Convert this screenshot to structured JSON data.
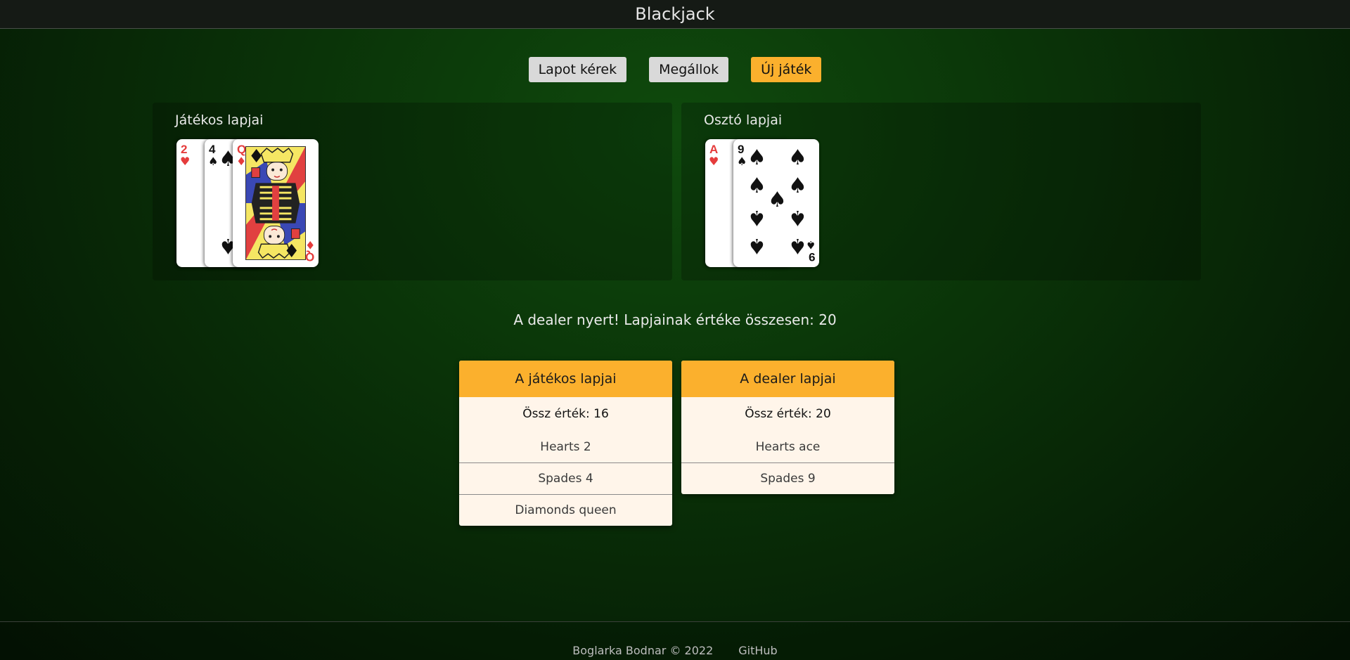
{
  "header": {
    "title": "Blackjack"
  },
  "controls": {
    "hit_label": "Lapot kérek",
    "stand_label": "Megállok",
    "new_game_label": "Új játék"
  },
  "player_panel": {
    "title": "Játékos lapjai",
    "cards": [
      {
        "rank": "2",
        "suit": "hearts",
        "suit_glyph": "♥",
        "color": "#e53b3b"
      },
      {
        "rank": "4",
        "suit": "spades",
        "suit_glyph": "♠",
        "color": "#111111"
      },
      {
        "rank": "Q",
        "suit": "diamonds",
        "suit_glyph": "♦",
        "color": "#e53b3b"
      }
    ]
  },
  "dealer_panel": {
    "title": "Osztó lapjai",
    "cards": [
      {
        "rank": "A",
        "suit": "hearts",
        "suit_glyph": "♥",
        "color": "#e53b3b"
      },
      {
        "rank": "9",
        "suit": "spades",
        "suit_glyph": "♠",
        "color": "#111111"
      }
    ]
  },
  "status_message": "A dealer nyert! Lapjainak értéke összesen: 20",
  "player_summary": {
    "title": "A játékos lapjai",
    "total": "Össz érték: 16",
    "cards": [
      "Hearts 2",
      "Spades 4",
      "Diamonds queen"
    ]
  },
  "dealer_summary": {
    "title": "A dealer lapjai",
    "total": "Össz érték: 20",
    "cards": [
      "Hearts ace",
      "Spades 9"
    ]
  },
  "footer": {
    "credit": "Boglarka Bodnar © 2022",
    "link_label": "GitHub"
  },
  "colors": {
    "accent": "#fbb02d",
    "button_grey": "#d9d9d9",
    "summary_bg": "#fff5ea",
    "felt_green": "#0a3308"
  }
}
